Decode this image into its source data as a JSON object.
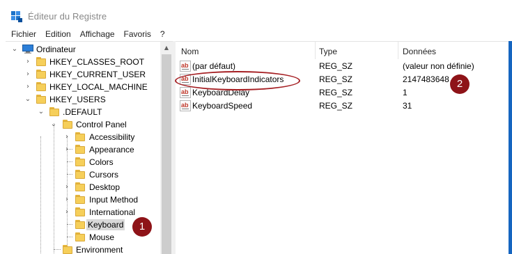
{
  "window": {
    "title": "Éditeur du Registre",
    "app_icon": "regedit-icon"
  },
  "menu": [
    "Fichier",
    "Edition",
    "Affichage",
    "Favoris",
    "?"
  ],
  "tree": {
    "root": "Ordinateur",
    "hives": [
      "HKEY_CLASSES_ROOT",
      "HKEY_CURRENT_USER",
      "HKEY_LOCAL_MACHINE",
      "HKEY_USERS"
    ],
    "default_key": ".DEFAULT",
    "control_panel": "Control Panel",
    "children": [
      "Accessibility",
      "Appearance",
      "Colors",
      "Cursors",
      "Desktop",
      "Input Method",
      "International",
      "Keyboard",
      "Mouse"
    ],
    "after": "Environment",
    "selected": "Keyboard"
  },
  "list": {
    "columns": {
      "name": "Nom",
      "type": "Type",
      "data": "Données"
    },
    "rows": [
      {
        "name": "(par défaut)",
        "type": "REG_SZ",
        "data": "(valeur non définie)"
      },
      {
        "name": "InitialKeyboardIndicators",
        "type": "REG_SZ",
        "data": "2147483648"
      },
      {
        "name": "KeyboardDelay",
        "type": "REG_SZ",
        "data": "1"
      },
      {
        "name": "KeyboardSpeed",
        "type": "REG_SZ",
        "data": "31"
      }
    ],
    "value_icon": "ab"
  },
  "annotations": {
    "badge_1": "1",
    "badge_2": "2"
  },
  "colors": {
    "annotation": "#8e1318",
    "folder": "#f6cf5a",
    "selection": "#d9d9d9"
  }
}
